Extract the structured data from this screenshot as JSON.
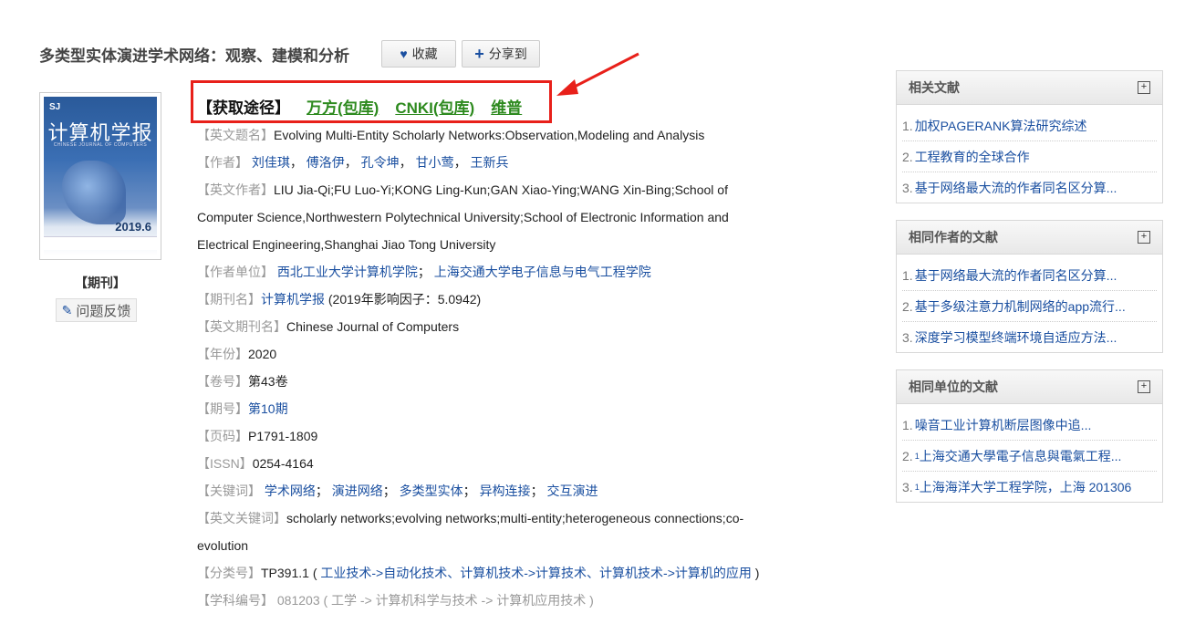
{
  "header": {
    "title": "多类型实体演进学术网络：观察、建模和分析",
    "favorite_label": "收藏",
    "share_label": "分享到"
  },
  "cover": {
    "logo": "SJ",
    "journal_name": "计算机学报",
    "journal_en": "CHINESE JOURNAL OF COMPUTERS",
    "issue": "2019.6"
  },
  "sidebar": {
    "type_label": "【期刊】",
    "feedback_label": "问题反馈"
  },
  "access": {
    "label": "【获取途径】",
    "links": [
      "万方(包库)",
      "CNKI(包库)",
      "维普"
    ]
  },
  "meta": {
    "en_title_key": "【英文题名】",
    "en_title": "Evolving Multi-Entity Scholarly Networks:Observation,Modeling and Analysis",
    "authors_key": "【作者】",
    "authors": [
      "刘佳琪",
      "傅洛伊",
      "孔令坤",
      "甘小莺",
      "王新兵"
    ],
    "en_authors_key": "【英文作者】",
    "en_authors": "LIU Jia-Qi;FU Luo-Yi;KONG Ling-Kun;GAN Xiao-Ying;WANG Xin-Bing;School of Computer Science,Northwestern Polytechnical University;School of Electronic Information and Electrical Engineering,Shanghai Jiao Tong University",
    "affil_key": "【作者单位】",
    "affils": [
      "西北工业大学计算机学院",
      "上海交通大学电子信息与电气工程学院"
    ],
    "journal_key": "【期刊名】",
    "journal": "计算机学报",
    "impact": "(2019年影响因子：5.0942)",
    "en_journal_key": "【英文期刊名】",
    "en_journal": "Chinese Journal of Computers",
    "year_key": "【年份】",
    "year": "2020",
    "volume_key": "【卷号】",
    "volume": "第43卷",
    "issue_key": "【期号】",
    "issue": "第10期",
    "pages_key": "【页码】",
    "pages": "P1791-1809",
    "issn_key": "【ISSN】",
    "issn": "0254-4164",
    "keywords_key": "【关键词】",
    "keywords": [
      "学术网络",
      "演进网络",
      "多类型实体",
      "异构连接",
      "交互演进"
    ],
    "en_keywords_key": "【英文关键词】",
    "en_keywords": "scholarly networks;evolving networks;multi-entity;heterogeneous connections;co-evolution",
    "class_key": "【分类号】",
    "class_code": "TP391.1 (",
    "class_link": "工业技术->自动化技术、计算机技术->计算技术、计算机技术->计算机的应用",
    "class_close": ")",
    "subject_partial": "【学科编号】 081203 ( 工学 -> 计算机科学与技术 -> 计算机应用技术 )"
  },
  "panels": [
    {
      "title": "相关文献",
      "items": [
        "加权PAGERANK算法研究综述",
        "工程教育的全球合作",
        "基于网络最大流的作者同名区分算..."
      ]
    },
    {
      "title": "相同作者的文献",
      "items": [
        "基于网络最大流的作者同名区分算...",
        "基于多级注意力机制网络的app流行...",
        "深度学习模型终端环境自适应方法..."
      ]
    },
    {
      "title": "相同单位的文献",
      "items": [
        "噪音工业计算机断层图像中追...",
        "上海交通大學電子信息與電氣工程...",
        "上海海洋大学工程学院，上海 201306"
      ]
    }
  ],
  "colors": {
    "link": "#1a4fa0",
    "access_link": "#2d8a1e",
    "highlight_box": "#e8201a"
  }
}
